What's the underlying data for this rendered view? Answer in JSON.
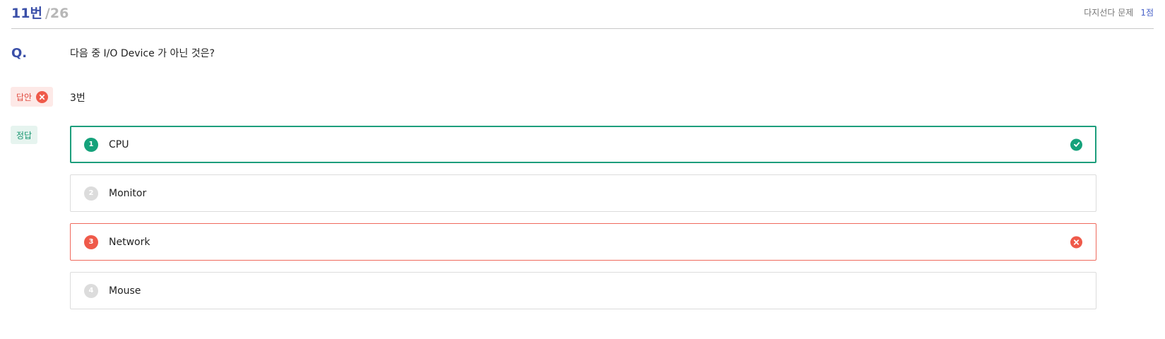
{
  "header": {
    "question_number": "11번",
    "total": "/26",
    "question_type": "다지선다 문제",
    "points": "1점"
  },
  "question": {
    "label": "Q.",
    "text": "다음 중 I/O Device 가 아닌 것은?"
  },
  "answer": {
    "label": "답안",
    "value": "3번",
    "status_icon": "x-circle-icon"
  },
  "correct": {
    "label": "정답"
  },
  "options": [
    {
      "number": "1",
      "text": "CPU",
      "state": "correct"
    },
    {
      "number": "2",
      "text": "Monitor",
      "state": "none"
    },
    {
      "number": "3",
      "text": "Network",
      "state": "wrong"
    },
    {
      "number": "4",
      "text": "Mouse",
      "state": "none"
    }
  ],
  "colors": {
    "accent": "#3a4fa8",
    "correct": "#15a27b",
    "wrong": "#ef5a4a",
    "neutral": "#dcdcdc"
  }
}
